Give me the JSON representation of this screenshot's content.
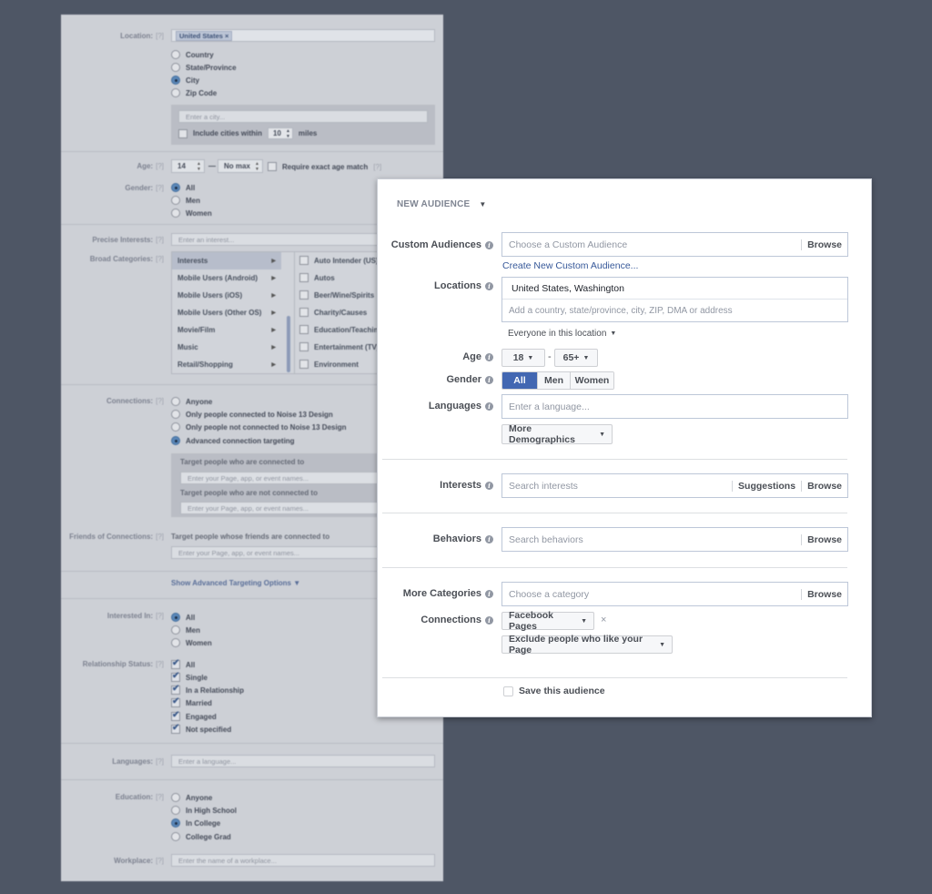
{
  "old_form": {
    "location": {
      "label": "Location:",
      "help": "[?]",
      "tag": "United States",
      "tag_remove": "×",
      "options": [
        {
          "label": "Country",
          "selected": false
        },
        {
          "label": "State/Province",
          "selected": false
        },
        {
          "label": "City",
          "selected": true
        },
        {
          "label": "Zip Code",
          "selected": false
        }
      ],
      "city_placeholder": "Enter a city...",
      "include_label": "Include cities within",
      "radius": "10",
      "radius_unit": "miles"
    },
    "age": {
      "label": "Age:",
      "help": "[?]",
      "min": "14",
      "dash": "—",
      "max": "No max",
      "exact_label": "Require exact age match",
      "exact_help": "[?]"
    },
    "gender": {
      "label": "Gender:",
      "help": "[?]",
      "options": [
        {
          "label": "All",
          "selected": true
        },
        {
          "label": "Men",
          "selected": false
        },
        {
          "label": "Women",
          "selected": false
        }
      ]
    },
    "precise_interests": {
      "label": "Precise Interests:",
      "help": "[?]",
      "placeholder": "Enter an interest..."
    },
    "broad_categories": {
      "label": "Broad Categories:",
      "help": "[?]",
      "categories": [
        "Interests",
        "Mobile Users (Android)",
        "Mobile Users (iOS)",
        "Mobile Users (Other OS)",
        "Movie/Film",
        "Music",
        "Retail/Shopping"
      ],
      "selected_category": "Interests",
      "subcategories": [
        "Auto Intender (US)",
        "Autos",
        "Beer/Wine/Spirits",
        "Charity/Causes",
        "Education/Teaching",
        "Entertainment (TV)",
        "Environment"
      ]
    },
    "connections": {
      "label": "Connections:",
      "help": "[?]",
      "options": [
        {
          "label": "Anyone",
          "selected": false
        },
        {
          "label": "Only people connected to Noise 13 Design",
          "selected": false
        },
        {
          "label": "Only people not connected to Noise 13 Design",
          "selected": false
        },
        {
          "label": "Advanced connection targeting",
          "selected": true
        }
      ],
      "connected_label": "Target people who are connected to",
      "connected_placeholder": "Enter your Page, app, or event names...",
      "not_connected_label": "Target people who are not connected to",
      "not_connected_placeholder": "Enter your Page, app, or event names..."
    },
    "friends_of_connections": {
      "label": "Friends of Connections:",
      "help": "[?]",
      "text": "Target people whose friends are connected to",
      "placeholder": "Enter your Page, app, or event names..."
    },
    "advanced_link": "Show Advanced Targeting Options",
    "interested_in": {
      "label": "Interested In:",
      "help": "[?]",
      "options": [
        {
          "label": "All",
          "selected": true
        },
        {
          "label": "Men",
          "selected": false
        },
        {
          "label": "Women",
          "selected": false
        }
      ]
    },
    "relationship_status": {
      "label": "Relationship Status:",
      "help": "[?]",
      "options": [
        {
          "label": "All",
          "checked": true
        },
        {
          "label": "Single",
          "checked": true
        },
        {
          "label": "In a Relationship",
          "checked": true
        },
        {
          "label": "Married",
          "checked": true
        },
        {
          "label": "Engaged",
          "checked": true
        },
        {
          "label": "Not specified",
          "checked": true
        }
      ]
    },
    "languages": {
      "label": "Languages:",
      "help": "[?]",
      "placeholder": "Enter a language..."
    },
    "education": {
      "label": "Education:",
      "help": "[?]",
      "options": [
        {
          "label": "Anyone",
          "selected": false
        },
        {
          "label": "In High School",
          "selected": false
        },
        {
          "label": "In College",
          "selected": true
        },
        {
          "label": "College Grad",
          "selected": false
        }
      ]
    },
    "workplace": {
      "label": "Workplace:",
      "help": "[?]",
      "placeholder": "Enter the name of a workplace..."
    }
  },
  "panel": {
    "title": "NEW AUDIENCE",
    "custom_audiences": {
      "label": "Custom Audiences",
      "placeholder": "Choose a Custom Audience",
      "browse": "Browse",
      "create_link": "Create New Custom Audience..."
    },
    "locations": {
      "label": "Locations",
      "value": "United States, Washington",
      "placeholder": "Add a country, state/province, city, ZIP, DMA or address",
      "scope": "Everyone in this location"
    },
    "age": {
      "label": "Age",
      "min": "18",
      "separator": "-",
      "max": "65+"
    },
    "gender": {
      "label": "Gender",
      "options": [
        "All",
        "Men",
        "Women"
      ],
      "selected": "All"
    },
    "languages": {
      "label": "Languages",
      "placeholder": "Enter a language..."
    },
    "more_demographics": "More Demographics",
    "interests": {
      "label": "Interests",
      "placeholder": "Search interests",
      "suggestions": "Suggestions",
      "browse": "Browse"
    },
    "behaviors": {
      "label": "Behaviors",
      "placeholder": "Search behaviors",
      "browse": "Browse"
    },
    "more_categories": {
      "label": "More Categories",
      "placeholder": "Choose a category",
      "browse": "Browse"
    },
    "connections": {
      "label": "Connections",
      "type": "Facebook Pages",
      "remove": "×",
      "rule": "Exclude people who like your Page"
    },
    "save_audience": {
      "label": "Save this audience",
      "checked": false
    },
    "colors": {
      "accent": "#4267b2",
      "link": "#365899",
      "backdrop": "#4e5665"
    }
  }
}
